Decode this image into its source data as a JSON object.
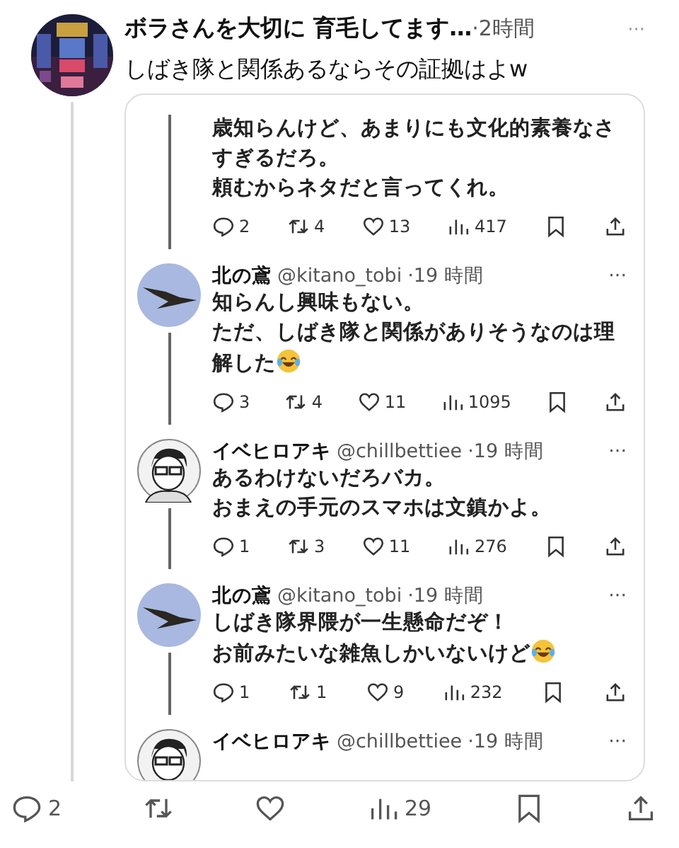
{
  "post": {
    "author": "ボラさんを大切に 育毛してます…",
    "time": "·2時間",
    "more": "···",
    "text": "しばき隊と関係あるならその証拠はよw"
  },
  "quoted": [
    {
      "kind": "cut",
      "lines": [
        "歳知らんけど、あまりにも文化的素養なさすぎるだろ。",
        "頼むからネタだと言ってくれ。"
      ],
      "emoji": false,
      "stats": {
        "replies": "2",
        "reposts": "4",
        "likes": "13",
        "views": "417"
      }
    },
    {
      "kind": "bird",
      "author": "北の鳶",
      "handle": "@kitano_tobi",
      "time": "·19 時間",
      "more": "···",
      "lines": [
        "知らんし興味もない。",
        "ただ、しばき隊と関係がありそうなのは理解した"
      ],
      "emoji": true,
      "stats": {
        "replies": "3",
        "reposts": "4",
        "likes": "11",
        "views": "1095"
      }
    },
    {
      "kind": "person",
      "author": "イベヒロアキ",
      "handle": "@chillbettiee",
      "time": "·19 時間",
      "more": "···",
      "lines": [
        "あるわけないだろバカ。",
        "おまえの手元のスマホは文鎮かよ。"
      ],
      "emoji": false,
      "stats": {
        "replies": "1",
        "reposts": "3",
        "likes": "11",
        "views": "276"
      }
    },
    {
      "kind": "bird",
      "author": "北の鳶",
      "handle": "@kitano_tobi",
      "time": "·19 時間",
      "more": "···",
      "lines": [
        "しばき隊界隈が一生懸命だぞ！",
        "お前みたいな雑魚しかいないけど"
      ],
      "emoji": true,
      "stats": {
        "replies": "1",
        "reposts": "1",
        "likes": "9",
        "views": "232"
      }
    },
    {
      "kind": "person",
      "author": "イベヒロアキ",
      "handle": "@chillbettiee",
      "time": "·19 時間",
      "more": "···"
    }
  ],
  "actions": {
    "replies": "2",
    "views": "29"
  }
}
